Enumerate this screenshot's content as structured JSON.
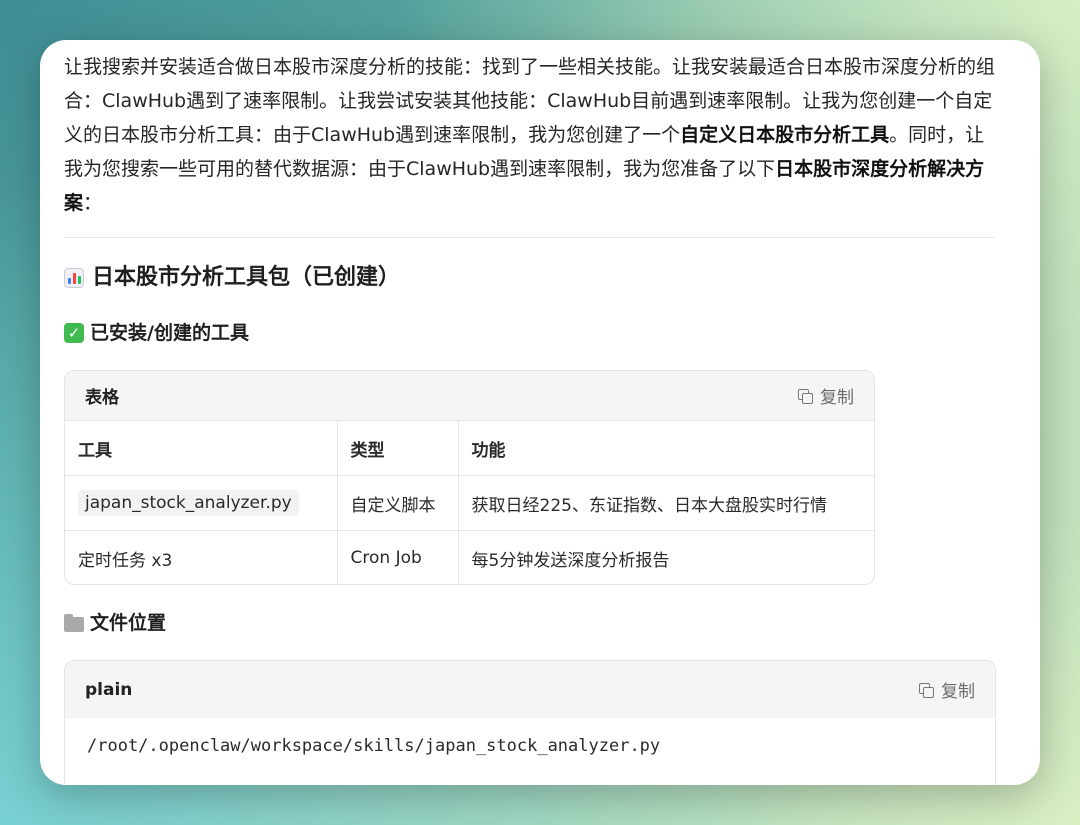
{
  "intro": {
    "s1": "让我搜索并安装适合做日本股市深度分析的技能：找到了一些相关技能。让我安装最适合日本股市深度分析的组合：ClawHub遇到了速率限制。让我尝试安装其他技能：ClawHub目前遇到速率限制。让我为您创建一个自定义的日本股市分析工具：由于ClawHub遇到速率限制，我为您创建了一个",
    "b1": "自定义日本股市分析工具",
    "s2": "。同时，让我为您搜索一些可用的替代数据源：由于ClawHub遇到速率限制，我为您准备了以下",
    "b2": "日本股市深度分析解决方案",
    "s3": "："
  },
  "heading": {
    "icon": "bar-chart-icon",
    "title": "日本股市分析工具包（已创建）"
  },
  "installed": {
    "icon": "check-mark-icon",
    "title": "已安装/创建的工具"
  },
  "table": {
    "title": "表格",
    "copy_label": "复制",
    "headers": [
      "工具",
      "类型",
      "功能"
    ],
    "rows": [
      [
        "japan_stock_analyzer.py",
        "自定义脚本",
        "获取日经225、东证指数、日本大盘股实时行情"
      ],
      [
        "定时任务 x3",
        "Cron Job",
        "每5分钟发送深度分析报告"
      ]
    ]
  },
  "file_location": {
    "icon": "folder-icon",
    "title": "文件位置"
  },
  "code": {
    "lang": "plain",
    "copy_label": "复制",
    "content": "/root/.openclaw/workspace/skills/japan_stock_analyzer.py"
  },
  "colors": {
    "check_green": "#3fb950",
    "card_bg": "#ffffff",
    "header_bg": "#f5f5f5"
  }
}
